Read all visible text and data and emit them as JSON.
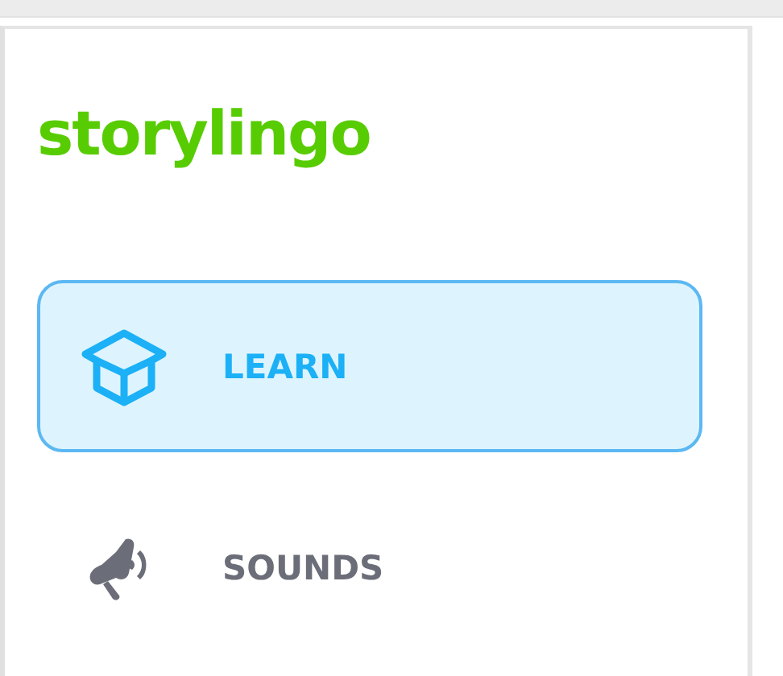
{
  "logo": "storylingo",
  "nav_items": [
    {
      "label": "LEARN",
      "kind": "box",
      "selected": true
    },
    {
      "label": "SOUNDS",
      "kind": "megaphone",
      "selected": false
    }
  ]
}
